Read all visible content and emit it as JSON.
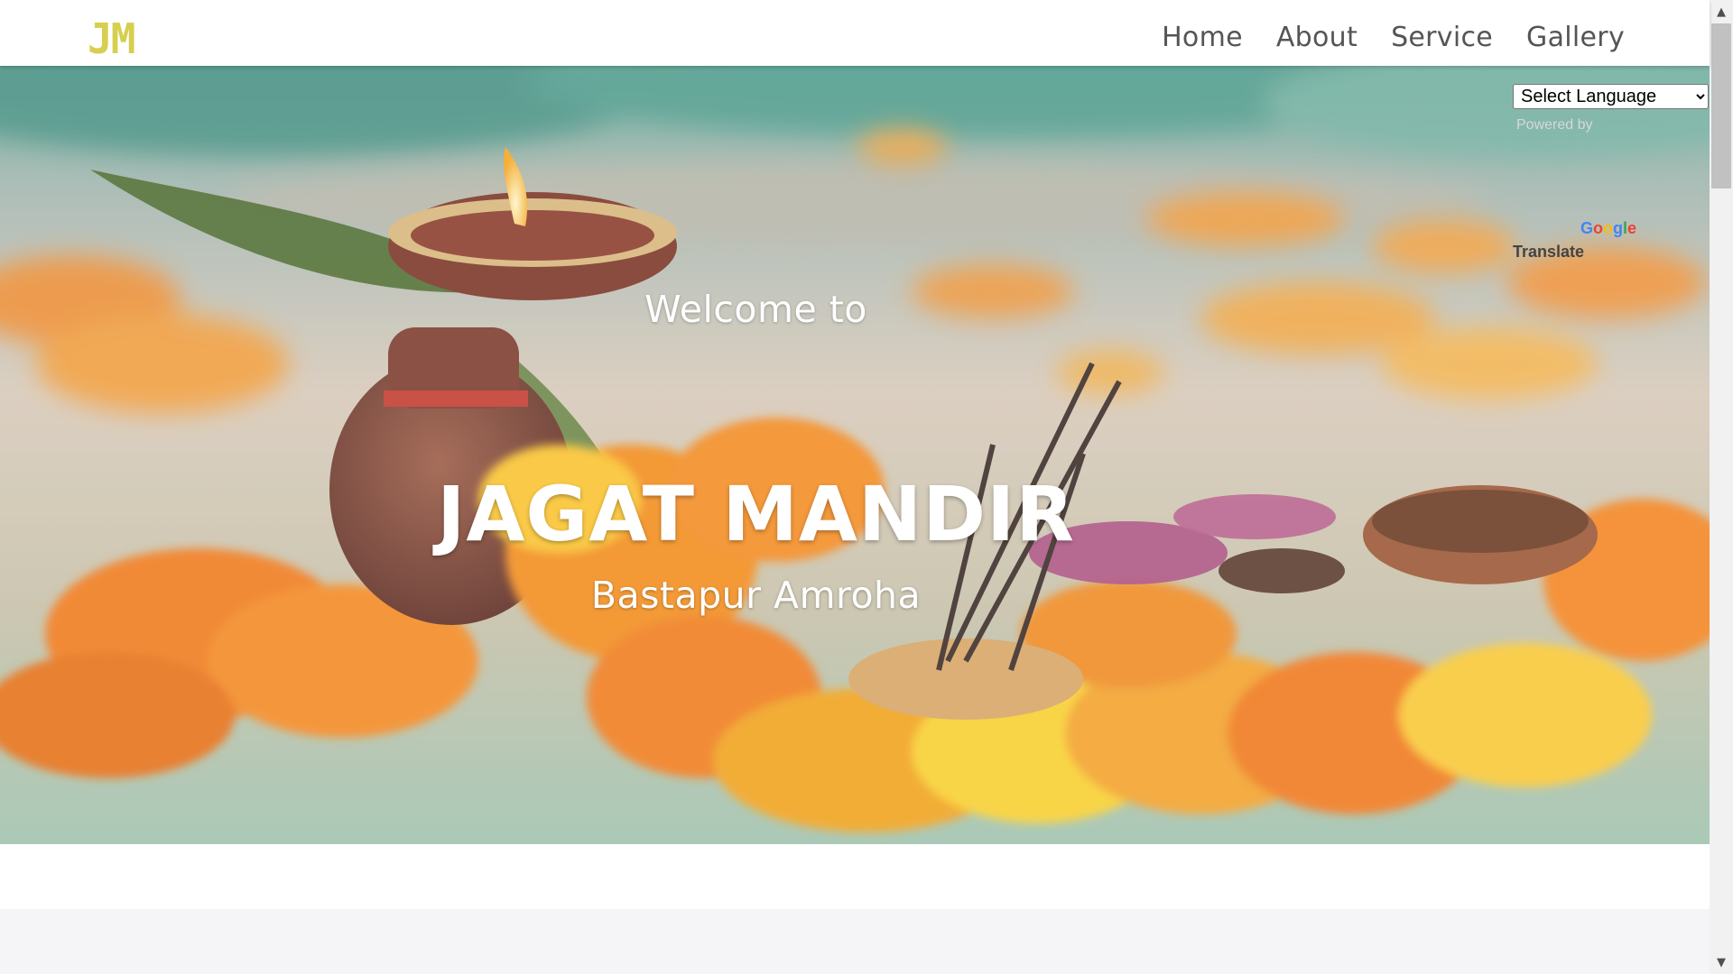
{
  "navbar": {
    "logo": "JM",
    "links": [
      {
        "label": "Home"
      },
      {
        "label": "About"
      },
      {
        "label": "Service"
      },
      {
        "label": "Gallery"
      }
    ]
  },
  "hero": {
    "welcome": "Welcome to",
    "title": "JAGAT MANDIR",
    "subtitle": "Bastapur Amroha",
    "background_icon": "puja-diya-marigold-image"
  },
  "translate": {
    "select_value": "Select Language",
    "powered_by": "Powered by",
    "google_letters": [
      "G",
      "o",
      "o",
      "g",
      "l",
      "e"
    ],
    "translate_label": "Translate"
  },
  "colors": {
    "logo": "#d6cf4f",
    "nav_text": "#555555",
    "hero_text": "#ffffff",
    "next_section_bg": "#f5f5f7"
  },
  "scrollbar": {
    "up_icon": "scroll-up-icon",
    "down_icon": "scroll-down-icon"
  }
}
